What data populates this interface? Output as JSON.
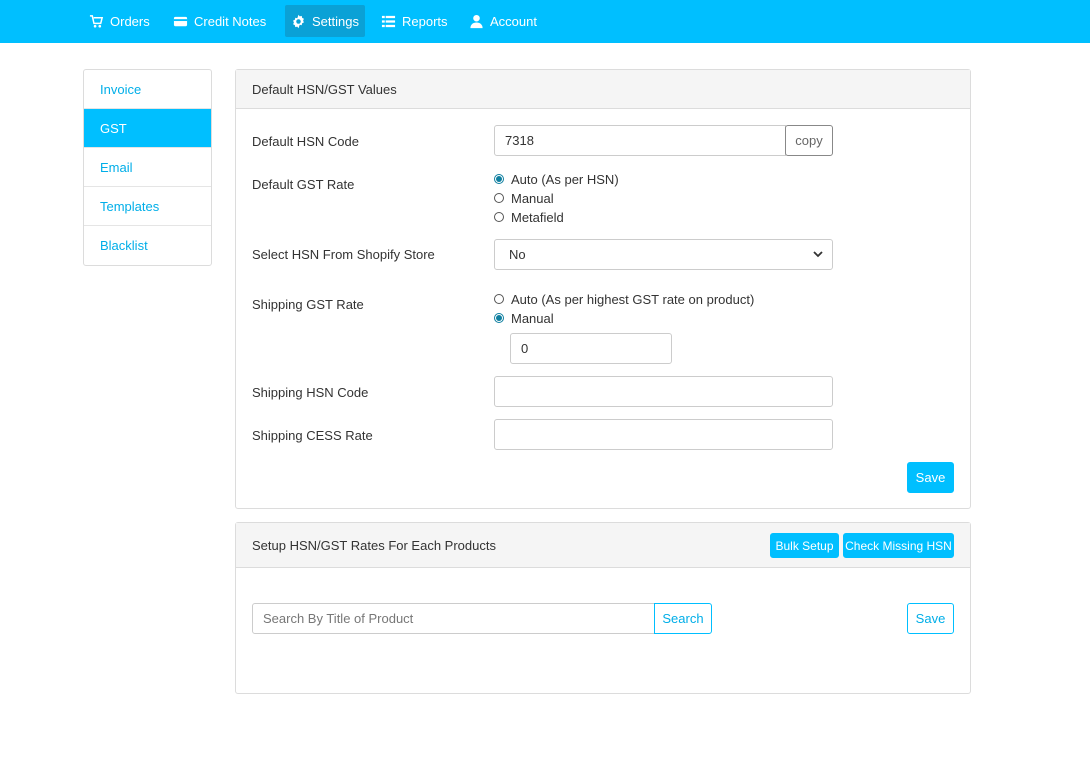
{
  "nav": {
    "items": [
      {
        "label": "Orders",
        "icon": "cart-icon"
      },
      {
        "label": "Credit Notes",
        "icon": "credit-card-icon"
      },
      {
        "label": "Settings",
        "icon": "gear-icon"
      },
      {
        "label": "Reports",
        "icon": "list-icon"
      },
      {
        "label": "Account",
        "icon": "user-icon"
      }
    ],
    "active": "Settings"
  },
  "sidebar": {
    "items": [
      {
        "label": "Invoice"
      },
      {
        "label": "GST"
      },
      {
        "label": "Email"
      },
      {
        "label": "Templates"
      },
      {
        "label": "Blacklist"
      }
    ],
    "active": "GST"
  },
  "defaults_panel": {
    "title": "Default HSN/GST Values",
    "hsn_code_label": "Default HSN Code",
    "hsn_code_value": "7318",
    "copy_label": "copy",
    "gst_rate_label": "Default GST Rate",
    "gst_rate_options": [
      {
        "label": "Auto (As per HSN)",
        "checked": true
      },
      {
        "label": "Manual",
        "checked": false
      },
      {
        "label": "Metafield",
        "checked": false
      }
    ],
    "select_hsn_label": "Select HSN From Shopify Store",
    "select_hsn_value": "No",
    "shipping_gst_label": "Shipping GST Rate",
    "shipping_gst_options": [
      {
        "label": "Auto (As per highest GST rate on product)",
        "checked": false
      },
      {
        "label": "Manual",
        "checked": true
      }
    ],
    "shipping_gst_manual_value": "0",
    "shipping_hsn_label": "Shipping HSN Code",
    "shipping_hsn_value": "",
    "shipping_cess_label": "Shipping CESS Rate",
    "shipping_cess_value": "",
    "save_label": "Save"
  },
  "products_panel": {
    "title": "Setup HSN/GST Rates For Each Products",
    "bulk_setup_label": "Bulk Setup",
    "check_missing_label": "Check Missing HSN",
    "search_placeholder": "Search By Title of Product",
    "search_button_label": "Search",
    "save_label": "Save"
  },
  "colors": {
    "brand": "#00bfff",
    "nav_active": "#0aa1d6",
    "link": "#00aee8"
  }
}
